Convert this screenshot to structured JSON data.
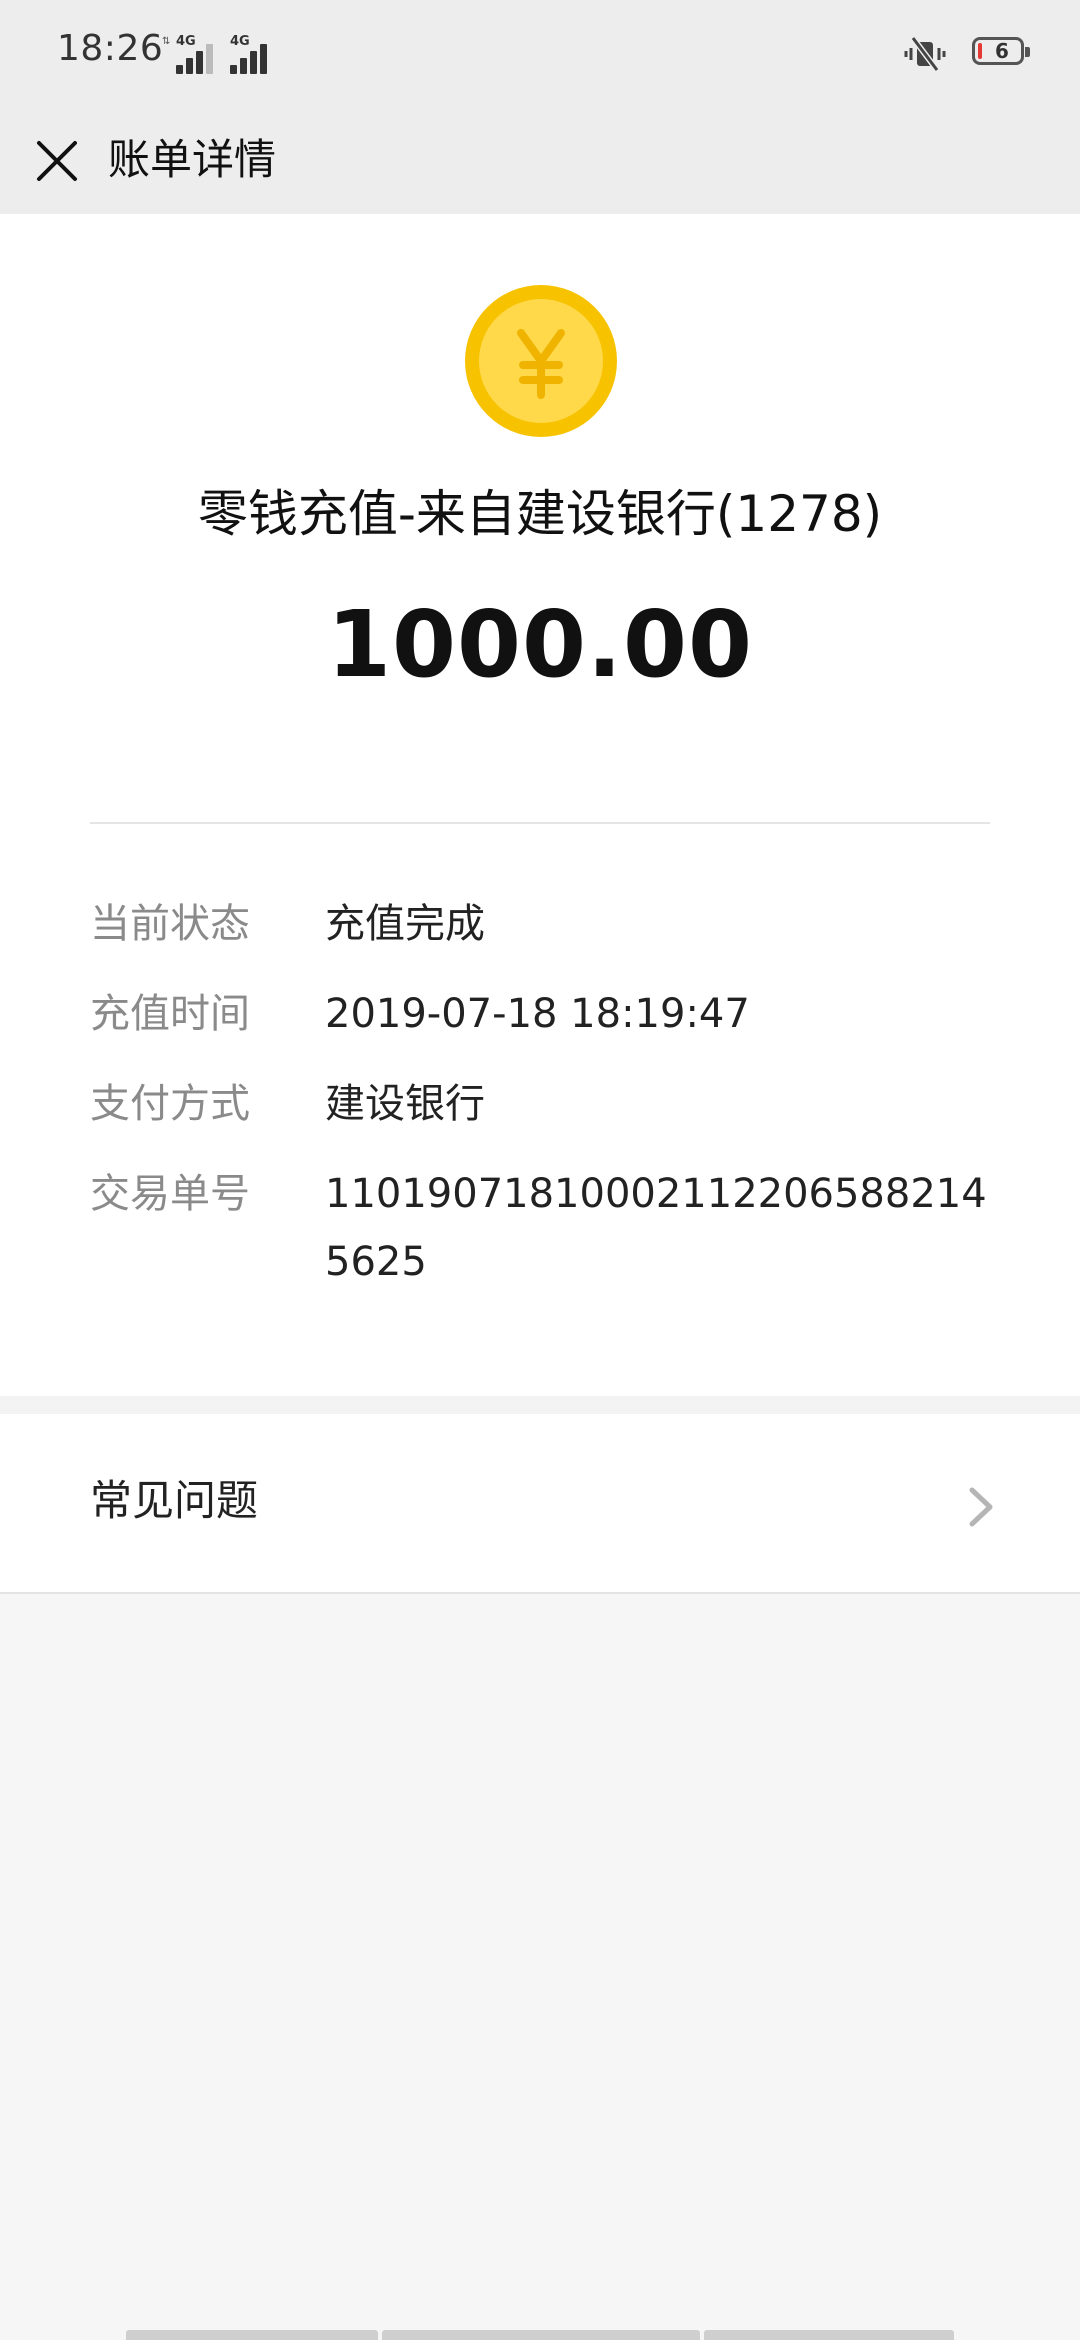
{
  "status_bar": {
    "time": "18:26",
    "network_1": "4G",
    "network_2": "4G",
    "battery": "6",
    "icons": [
      "signal-icon",
      "signal-icon",
      "mute-vibrate-icon",
      "battery-icon"
    ]
  },
  "header": {
    "title": "账单详情",
    "close_icon": "close-icon"
  },
  "transaction": {
    "icon": "yen-coin-icon",
    "title": "零钱充值-来自建设银行(1278)",
    "amount": "1000.00"
  },
  "details": [
    {
      "label": "当前状态",
      "value": "充值完成"
    },
    {
      "label": "充值时间",
      "value": "2019-07-18 18:19:47"
    },
    {
      "label": "支付方式",
      "value": "建设银行"
    },
    {
      "label": "交易单号",
      "value": "110190718100021122065882145625"
    }
  ],
  "faq": {
    "label": "常见问题",
    "icon": "chevron-right-icon"
  },
  "colors": {
    "coin_outer": "#f7c200",
    "coin_inner": "#ffd94a",
    "coin_symbol": "#f0b400",
    "header_bg": "#ededed",
    "page_bg": "#f6f6f6"
  }
}
